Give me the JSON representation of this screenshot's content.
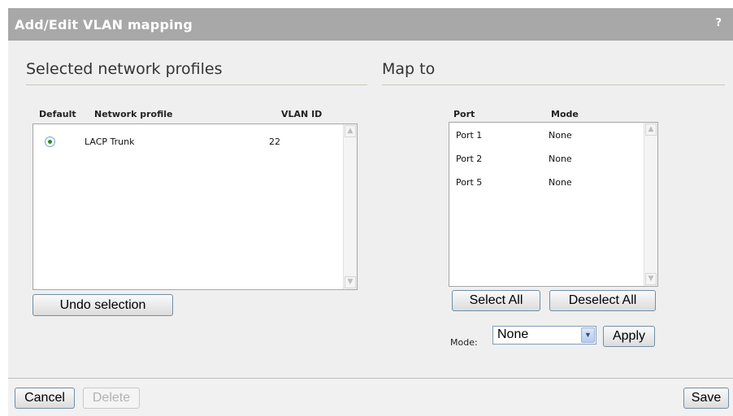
{
  "dialog": {
    "title": "Add/Edit VLAN mapping",
    "help_label": "?"
  },
  "left": {
    "heading": "Selected network profiles",
    "columns": {
      "default": "Default",
      "network_profile": "Network profile",
      "vlan_id": "VLAN ID"
    },
    "rows": [
      {
        "default_selected": true,
        "network_profile": "LACP Trunk",
        "vlan_id": "22"
      }
    ],
    "undo_label": "Undo selection"
  },
  "right": {
    "heading": "Map to",
    "columns": {
      "port": "Port",
      "mode": "Mode"
    },
    "rows": [
      {
        "port": "Port 1",
        "mode": "None"
      },
      {
        "port": "Port 2",
        "mode": "None"
      },
      {
        "port": "Port 5",
        "mode": "None"
      }
    ],
    "select_all_label": "Select All",
    "deselect_all_label": "Deselect All",
    "mode_label": "Mode:",
    "mode_value": "None",
    "apply_label": "Apply"
  },
  "footer": {
    "cancel_label": "Cancel",
    "delete_label": "Delete",
    "save_label": "Save"
  },
  "colors": {
    "titlebar": "#a8a8a8",
    "panel": "#efefef",
    "radio_dot": "#2e8a2e",
    "button_border": "#6f8fa6"
  }
}
